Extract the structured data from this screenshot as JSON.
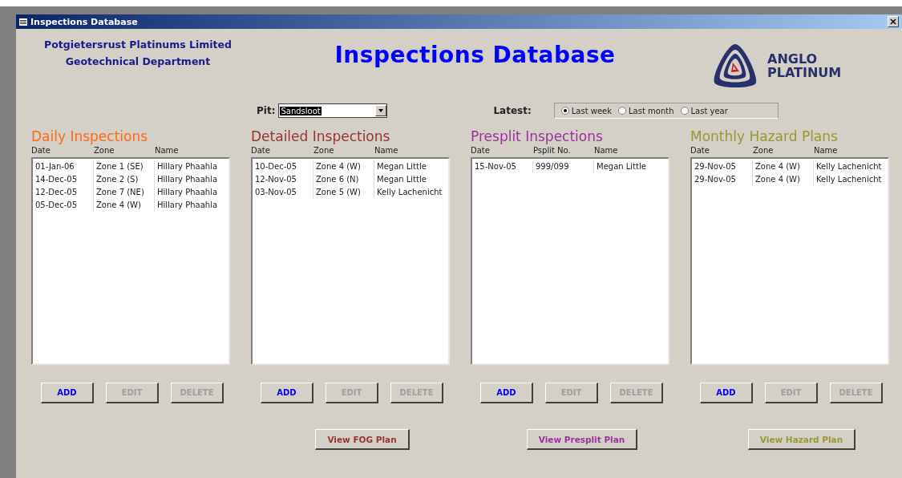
{
  "window": {
    "title": "Inspections Database"
  },
  "header": {
    "company": "Potgietersrust Platinums Limited",
    "department": "Geotechnical Department",
    "title": "Inspections Database",
    "logo_text": [
      "ANGLO",
      "PLATINUM"
    ]
  },
  "pit": {
    "label": "Pit:",
    "value": "Sandsloot"
  },
  "latest": {
    "label": "Latest:",
    "options": [
      {
        "label": "Last week",
        "selected": true
      },
      {
        "label": "Last month",
        "selected": false
      },
      {
        "label": "Last year",
        "selected": false
      }
    ]
  },
  "panels": [
    {
      "title": "Daily Inspections",
      "color": "#ff6a13",
      "columns": [
        "Date",
        "Zone",
        "Name"
      ],
      "rows": [
        [
          "01-Jan-06",
          "Zone 1 (SE)",
          "Hillary Phaahla"
        ],
        [
          "14-Dec-05",
          "Zone 2 (S)",
          "Hillary Phaahla"
        ],
        [
          "12-Dec-05",
          "Zone 7 (NE)",
          "Hillary Phaahla"
        ],
        [
          "05-Dec-05",
          "Zone 4 (W)",
          "Hillary Phaahla"
        ]
      ],
      "buttons": [
        {
          "label": "ADD",
          "disabled": false
        },
        {
          "label": "EDIT",
          "disabled": true
        },
        {
          "label": "DELETE",
          "disabled": true
        }
      ]
    },
    {
      "title": "Detailed Inspections",
      "color": "#993333",
      "columns": [
        "Date",
        "Zone",
        "Name"
      ],
      "rows": [
        [
          "10-Dec-05",
          "Zone 4 (W)",
          "Megan Little"
        ],
        [
          "12-Nov-05",
          "Zone 6 (N)",
          "Megan Little"
        ],
        [
          "03-Nov-05",
          "Zone 5 (W)",
          "Kelly Lachenicht"
        ]
      ],
      "buttons": [
        {
          "label": "ADD",
          "disabled": false
        },
        {
          "label": "EDIT",
          "disabled": true
        },
        {
          "label": "DELETE",
          "disabled": true
        }
      ],
      "view_button": "View FOG Plan"
    },
    {
      "title": "Presplit Inspections",
      "color": "#993399",
      "columns": [
        "Date",
        "Psplit No.",
        "Name"
      ],
      "rows": [
        [
          "15-Nov-05",
          "999/099",
          "Megan Little"
        ]
      ],
      "buttons": [
        {
          "label": "ADD",
          "disabled": false
        },
        {
          "label": "EDIT",
          "disabled": true
        },
        {
          "label": "DELETE",
          "disabled": true
        }
      ],
      "view_button": "View Presplit Plan"
    },
    {
      "title": "Monthly Hazard Plans",
      "color": "#999933",
      "columns": [
        "Date",
        "Zone",
        "Name"
      ],
      "rows": [
        [
          "29-Nov-05",
          "Zone 4 (W)",
          "Kelly Lachenicht"
        ],
        [
          "29-Nov-05",
          "Zone 4 (W)",
          "Kelly Lachenicht"
        ]
      ],
      "buttons": [
        {
          "label": "ADD",
          "disabled": false
        },
        {
          "label": "EDIT",
          "disabled": true
        },
        {
          "label": "DELETE",
          "disabled": true
        }
      ],
      "view_button": "View Hazard Plan"
    }
  ]
}
